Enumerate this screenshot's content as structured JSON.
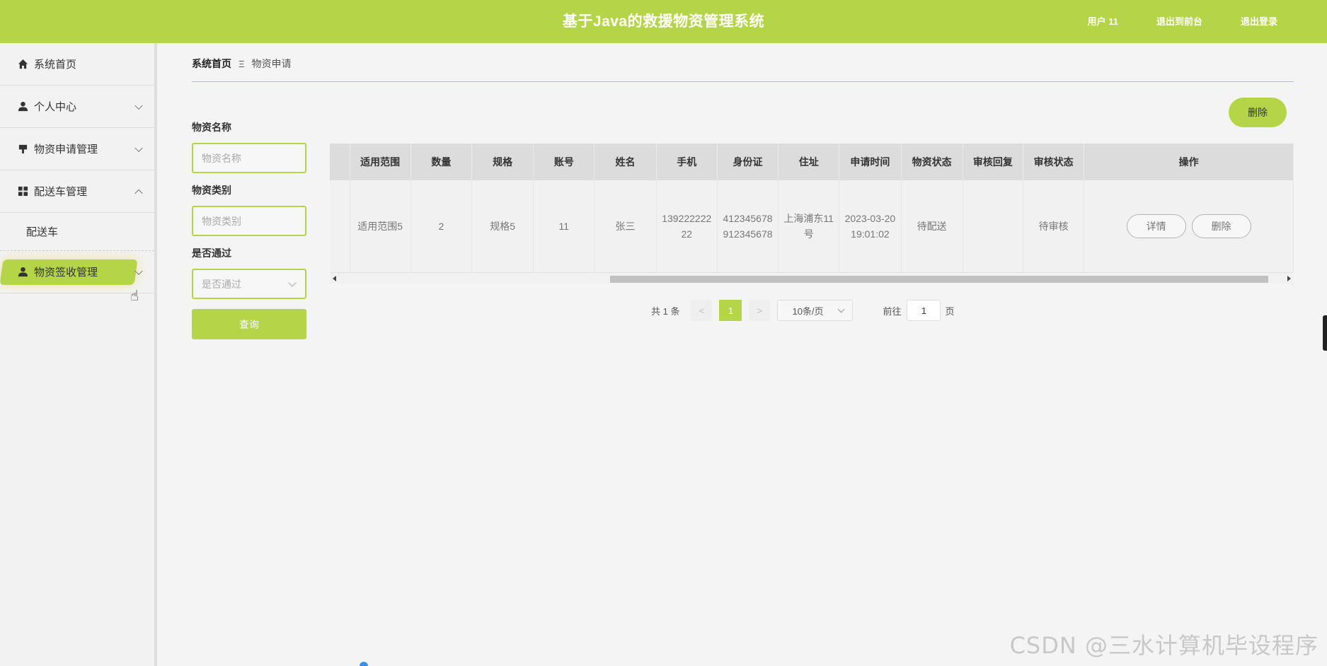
{
  "header": {
    "title": "基于Java的救援物资管理系统",
    "links": [
      "用户 11",
      "退出到前台",
      "退出登录"
    ]
  },
  "sidebar": {
    "items": [
      {
        "label": "系统首页",
        "icon": "home-icon"
      },
      {
        "label": "个人中心",
        "icon": "user-icon"
      },
      {
        "label": "物资申请管理",
        "icon": "flag-icon"
      },
      {
        "label": "配送车管理",
        "icon": "grid-icon"
      },
      {
        "label": "物资签收管理",
        "icon": "user-icon"
      }
    ],
    "submenu": "配送车"
  },
  "breadcrumb": {
    "home": "系统首页",
    "sep": "Ξ",
    "current": "物资申请"
  },
  "toolbar": {
    "delete_label": "删除"
  },
  "search": {
    "name_label": "物资名称",
    "name_placeholder": "物资名称",
    "category_label": "物资类别",
    "category_placeholder": "物资类别",
    "pass_label": "是否通过",
    "pass_placeholder": "是否通过",
    "query_label": "查询"
  },
  "table": {
    "headers": [
      "适用范围",
      "数量",
      "规格",
      "账号",
      "姓名",
      "手机",
      "身份证",
      "住址",
      "申请时间",
      "物资状态",
      "审核回复",
      "审核状态",
      "操作"
    ],
    "rows": [
      {
        "scope": "适用范围5",
        "qty": "2",
        "spec": "规格5",
        "account": "11",
        "name": "张三",
        "phone": "13922222222",
        "idcard": "412345678912345678",
        "address": "上海浦东11号",
        "apply_time": "2023-03-20 19:01:02",
        "status": "待配送",
        "reply": "",
        "review": "待审核",
        "detail_label": "详情",
        "delete_label": "删除"
      }
    ]
  },
  "pagination": {
    "total": "共 1 条",
    "prev": "<",
    "current_page": "1",
    "next": ">",
    "page_size": "10条/页",
    "goto_label": "前往",
    "goto_value": "1",
    "page_unit": "页"
  },
  "watermark": "CSDN @三水计算机毕设程序",
  "colors": {
    "accent": "#b5d549"
  }
}
